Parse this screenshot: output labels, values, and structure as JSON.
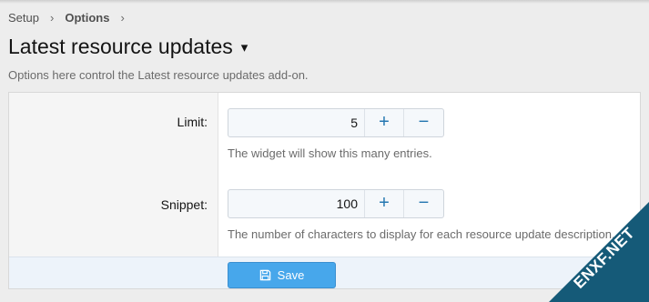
{
  "breadcrumb": {
    "items": [
      "Setup",
      "Options"
    ],
    "separator": "›"
  },
  "page": {
    "title": "Latest resource updates",
    "title_caret": "▾",
    "description": "Options here control the Latest resource updates add-on."
  },
  "options": [
    {
      "label": "Limit:",
      "value": "5",
      "plus": "+",
      "minus": "−",
      "explain": "The widget will show this many entries."
    },
    {
      "label": "Snippet:",
      "value": "100",
      "plus": "+",
      "minus": "−",
      "explain": "The number of characters to display for each resource update description."
    }
  ],
  "footer": {
    "save_label": "Save"
  },
  "watermark": {
    "text": "ENXF.NET"
  },
  "colors": {
    "accent": "#47a7eb",
    "stepper_icon": "#2577b1",
    "watermark_bg": "#155a78"
  }
}
